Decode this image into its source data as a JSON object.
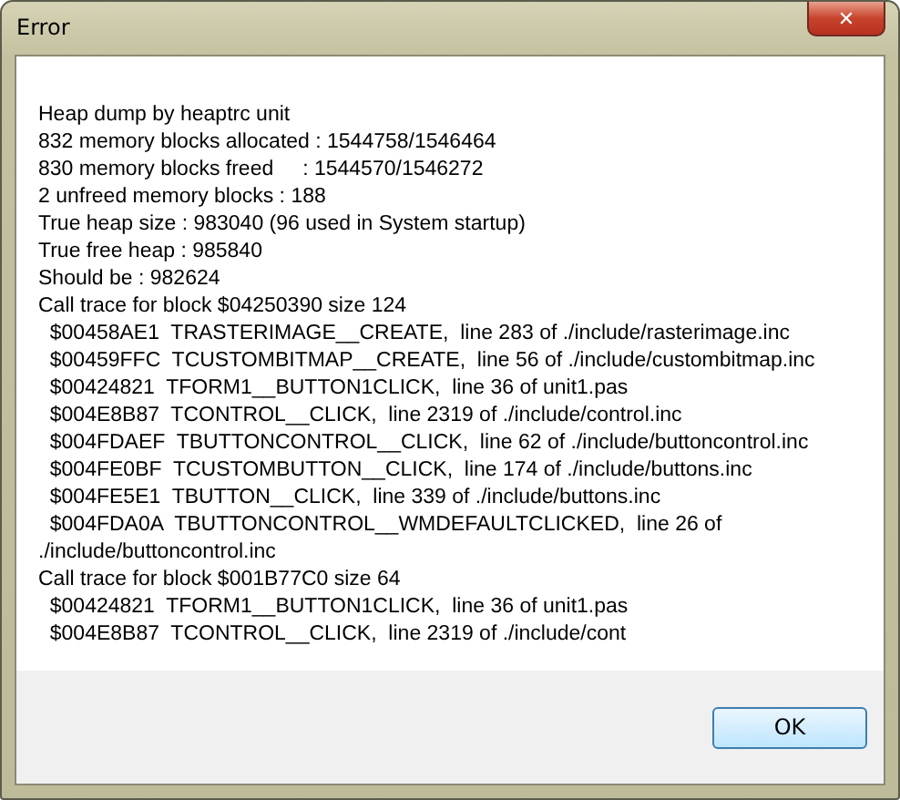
{
  "window": {
    "title": "Error",
    "close_glyph": "✕"
  },
  "message": {
    "lines": [
      "Heap dump by heaptrc unit",
      "832 memory blocks allocated : 1544758/1546464",
      "830 memory blocks freed     : 1544570/1546272",
      "2 unfreed memory blocks : 188",
      "True heap size : 983040 (96 used in System startup)",
      "True free heap : 985840",
      "Should be : 982624",
      "Call trace for block $04250390 size 124",
      "  $00458AE1  TRASTERIMAGE__CREATE,  line 283 of ./include/rasterimage.inc",
      "  $00459FFC  TCUSTOMBITMAP__CREATE,  line 56 of ./include/custombitmap.inc",
      "  $00424821  TFORM1__BUTTON1CLICK,  line 36 of unit1.pas",
      "  $004E8B87  TCONTROL__CLICK,  line 2319 of ./include/control.inc",
      "  $004FDAEF  TBUTTONCONTROL__CLICK,  line 62 of ./include/buttoncontrol.inc",
      "  $004FE0BF  TCUSTOMBUTTON__CLICK,  line 174 of ./include/buttons.inc",
      "  $004FE5E1  TBUTTON__CLICK,  line 339 of ./include/buttons.inc",
      "  $004FDA0A  TBUTTONCONTROL__WMDEFAULTCLICKED,  line 26 of ./include/buttoncontrol.inc",
      "Call trace for block $001B77C0 size 64",
      "  $00424821  TFORM1__BUTTON1CLICK,  line 36 of unit1.pas",
      "  $004E8B87  TCONTROL__CLICK,  line 2319 of ./include/cont"
    ]
  },
  "buttons": [
    "OK"
  ]
}
